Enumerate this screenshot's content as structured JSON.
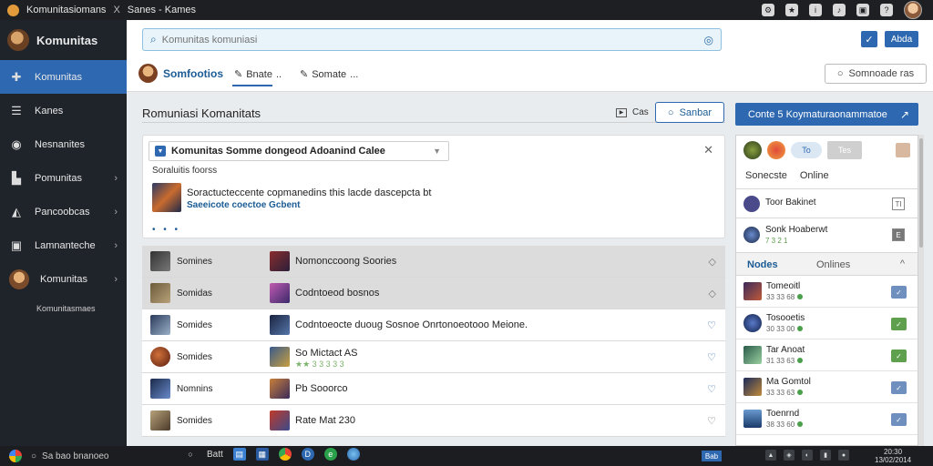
{
  "titlebar": {
    "tab_text": "Komunitasiomans",
    "close_glyph": "X",
    "title": "Sanes - Kames",
    "icons": [
      "settings-icon",
      "pin-icon",
      "info-icon",
      "bell-icon",
      "gift-icon",
      "help-icon"
    ]
  },
  "sidebar": {
    "title": "Komunitas",
    "items": [
      {
        "label": "Komunitas",
        "icon": "puzzle-icon",
        "active": true,
        "chevron": false
      },
      {
        "label": "Kanes",
        "icon": "menu-icon",
        "active": false,
        "chevron": false
      },
      {
        "label": "Nesnanites",
        "icon": "circle-icon",
        "active": false,
        "chevron": false
      },
      {
        "label": "Pomunitas",
        "icon": "chart-icon",
        "active": false,
        "chevron": true
      },
      {
        "label": "Pancoobcas",
        "icon": "mountain-icon",
        "active": false,
        "chevron": true
      },
      {
        "label": "Lamnanteche",
        "icon": "image-icon",
        "active": false,
        "chevron": true
      },
      {
        "label": "Komunitas",
        "icon": "avatar-icon",
        "active": false,
        "chevron": true
      }
    ],
    "footer": "Komunitasmaes"
  },
  "search": {
    "placeholder": "Komunitas komuniasi"
  },
  "top_buttons": {
    "check_glyph": "✓",
    "primary_label": "Abda"
  },
  "tabs": {
    "main_label": "Somfootios",
    "link1": "Bnate",
    "link1_extra": "..",
    "link2": "Somate",
    "link2_extra": "...",
    "filter_label": "Somnoade ras"
  },
  "section": {
    "title": "Romuniasi Komanitats",
    "small_label": "Cas",
    "outline_label": "Sanbar"
  },
  "post": {
    "dropdown_label": "Komunitas Somme dongeod Adoanind Calee",
    "subtitle": "Soraluitis foorss",
    "line1": "Soractucteccente copmanedins this lacde dascepcta bt",
    "line2": "Saeeicote coectoe Gcbent",
    "dots": "• • •"
  },
  "list": [
    {
      "name": "Somines",
      "desc": "Nomonccoong Soories",
      "desc2": "",
      "shaded": true,
      "action": "◇"
    },
    {
      "name": "Somidas",
      "desc": "Codntoeod bosnos",
      "desc2": "",
      "shaded": true,
      "action": "◇"
    },
    {
      "name": "Somides",
      "desc": "Codntoeocte duoug Sosnoe Onrtonoeotooo Meione.",
      "desc2": "",
      "shaded": false,
      "action": "♡"
    },
    {
      "name": "Somides",
      "desc": "So Mictact AS",
      "desc2": "★★ 3 3 3 3 3",
      "shaded": false,
      "action": "♡"
    },
    {
      "name": "Nomnins",
      "desc": "Pb   Sooorco",
      "desc2": "",
      "shaded": false,
      "action": "♡"
    },
    {
      "name": "Somides",
      "desc": "Rate Mat 230",
      "desc2": "",
      "shaded": false,
      "action": "♡"
    }
  ],
  "right_panel": {
    "cta_label": "Conte 5 Koymaturaonammatoe",
    "cta_arrow": "↗",
    "pill_label": "To",
    "square_label": "Tes",
    "status_left": "Sonecste",
    "status_right": "Online",
    "users": [
      {
        "name": "Toor Bakinet",
        "sub": "",
        "check": "TI"
      },
      {
        "name": "Sonk Hoaberwt",
        "sub": "7 3 2 1",
        "check": "E"
      }
    ],
    "tabs": {
      "left": "Nodes",
      "right": "Onlines",
      "arrow": "^"
    },
    "friends": [
      {
        "name": "Tomeoitl",
        "sub": "33 33 68",
        "btn_color": "#6f8fbf",
        "btn_glyph": "✓"
      },
      {
        "name": "Tosooetis",
        "sub": "30 33 00",
        "btn_color": "#5ea04d",
        "btn_glyph": "✓"
      },
      {
        "name": "Tar Anoat",
        "sub": "31 33 63",
        "btn_color": "#5ea04d",
        "btn_glyph": "✓"
      },
      {
        "name": "Ma Gomtol",
        "sub": "33 33 63",
        "btn_color": "#6f8fbf",
        "btn_glyph": "✓"
      },
      {
        "name": "Toenrnd",
        "sub": "38 33 60",
        "btn_color": "#6f8fbf",
        "btn_glyph": "✓"
      }
    ]
  },
  "taskbar": {
    "search_text": "Sa bao bnanoeo",
    "app_label": "Batt",
    "active_label": "Bab",
    "clock_top": "20:30",
    "clock_bottom": "13/02/2014"
  },
  "colors": {
    "accent": "#2d68b0",
    "sidebar_bg": "#1f232a",
    "titlebar_bg": "#1e1f22"
  }
}
